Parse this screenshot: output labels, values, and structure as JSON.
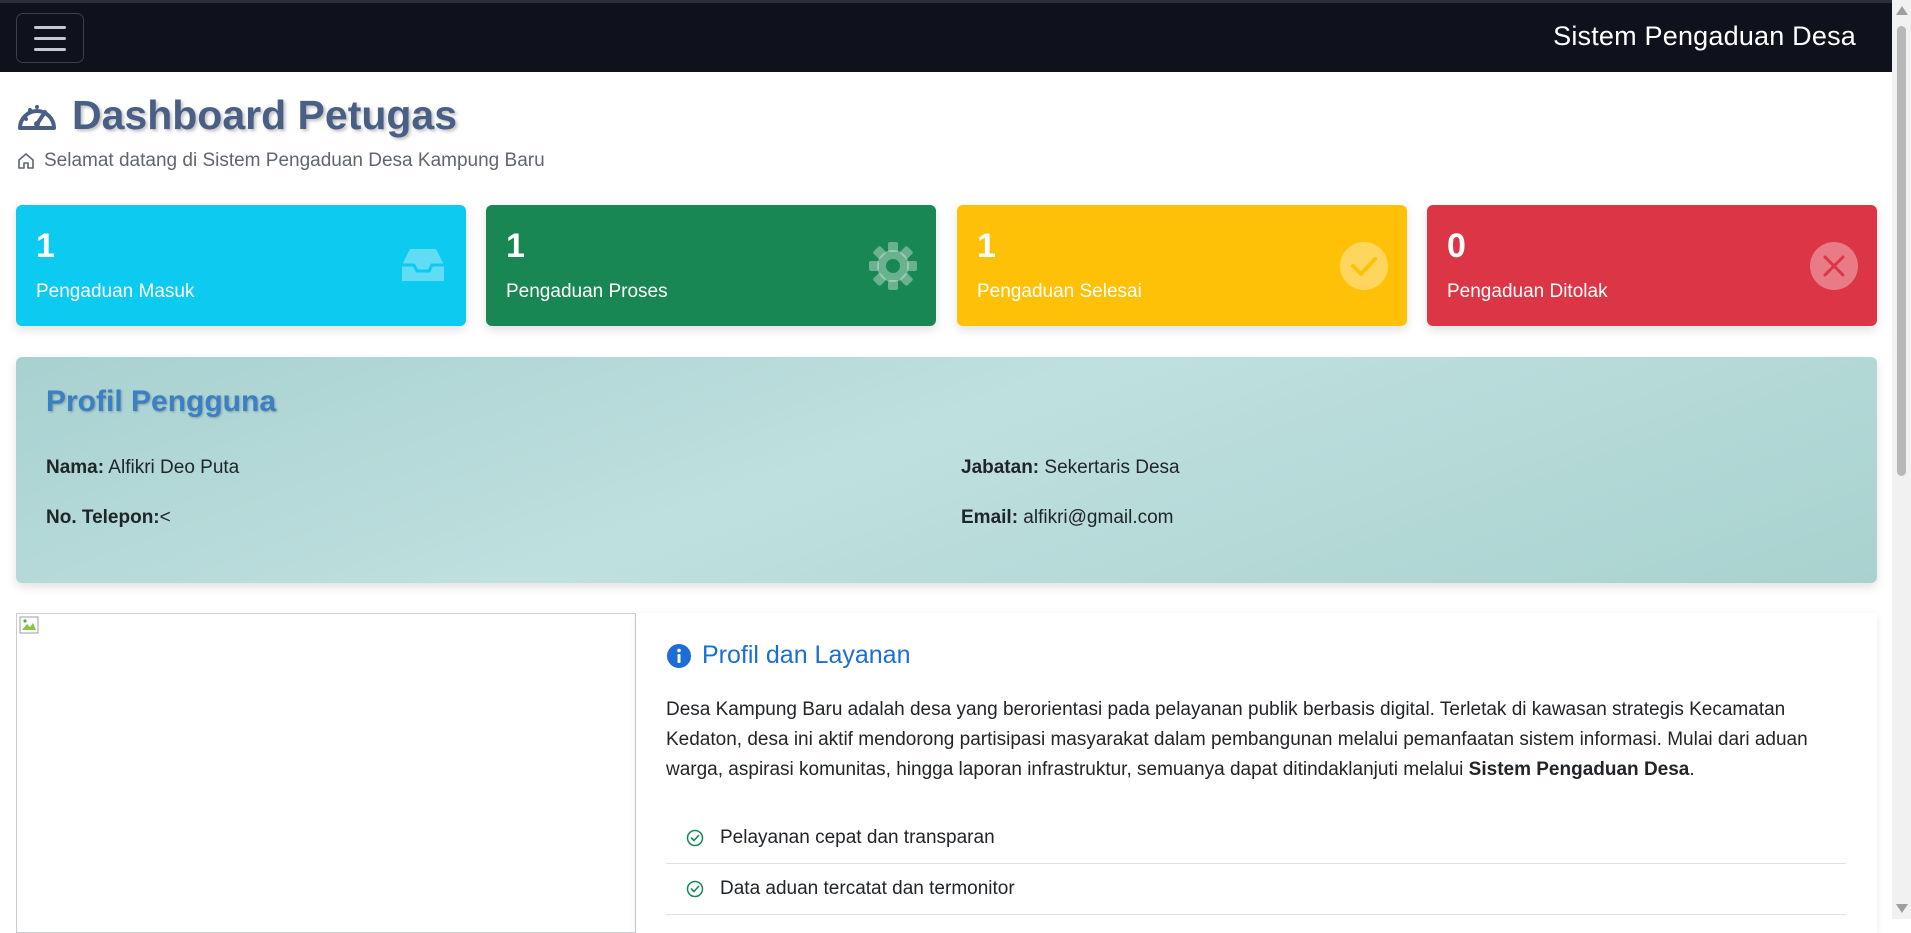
{
  "navbar": {
    "brand": "Sistem Pengaduan Desa"
  },
  "header": {
    "title": "Dashboard Petugas",
    "subtitle": "Selamat datang di Sistem Pengaduan Desa Kampung Baru"
  },
  "stats": [
    {
      "value": "1",
      "label": "Pengaduan Masuk",
      "color": "#0dcaf0",
      "icon": "inbox-icon"
    },
    {
      "value": "1",
      "label": "Pengaduan Proses",
      "color": "#198754",
      "icon": "gear-icon"
    },
    {
      "value": "1",
      "label": "Pengaduan Selesai",
      "color": "#ffc107",
      "icon": "check-circle-icon"
    },
    {
      "value": "0",
      "label": "Pengaduan Ditolak",
      "color": "#dc3545",
      "icon": "x-circle-icon"
    }
  ],
  "profile": {
    "title": "Profil Pengguna",
    "name_label": "Nama:",
    "name_value": " Alfikri Deo Puta",
    "phone_label": "No. Telepon:",
    "phone_value": "<",
    "position_label": "Jabatan:",
    "position_value": " Sekertaris Desa",
    "email_label": "Email:",
    "email_value": " alfikri@gmail.com"
  },
  "service": {
    "title": "Profil dan Layanan",
    "paragraph_main": "Desa Kampung Baru adalah desa yang berorientasi pada pelayanan publik berbasis digital. Terletak di kawasan strategis Kecamatan Kedaton, desa ini aktif mendorong partisipasi masyarakat dalam pembangunan melalui pemanfaatan sistem informasi. Mulai dari aduan warga, aspirasi komunitas, hingga laporan infrastruktur, semuanya dapat ditindaklanjuti melalui ",
    "paragraph_bold": "Sistem Pengaduan Desa",
    "paragraph_end": ".",
    "items": [
      "Pelayanan cepat dan transparan",
      "Data aduan tercatat dan termonitor"
    ]
  }
}
